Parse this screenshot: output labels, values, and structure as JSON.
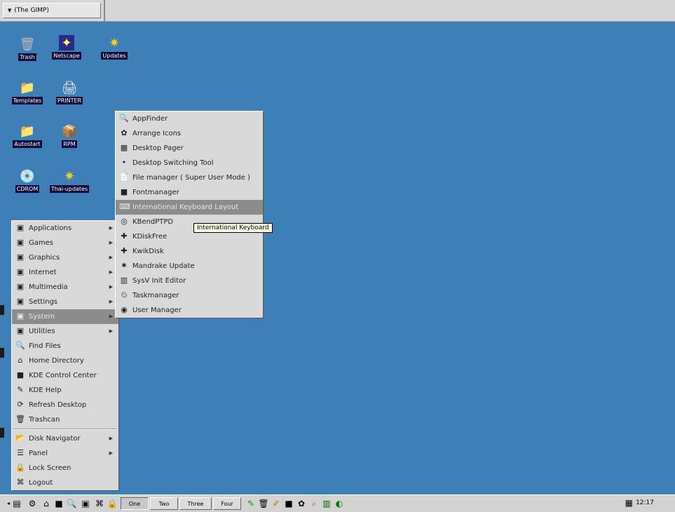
{
  "topbar": {
    "window_tab": "(The GIMP)"
  },
  "desktop_icons": [
    {
      "label": "Trash",
      "glyph": "🗑"
    },
    {
      "label": "Netscape",
      "glyph": "✦"
    },
    {
      "label": "Updates",
      "glyph": "✷"
    },
    {
      "label": "Templates",
      "glyph": "📁"
    },
    {
      "label": "PRINTER",
      "glyph": "🖨"
    },
    {
      "label": "Autostart",
      "glyph": "📁"
    },
    {
      "label": "RPM",
      "glyph": "📦"
    },
    {
      "label": "CDROM",
      "glyph": "💿"
    },
    {
      "label": "Thai-updates",
      "glyph": "✷"
    }
  ],
  "main_menu": [
    {
      "label": "Applications",
      "icon": "applications-icon",
      "glyph": "▣",
      "sub": true
    },
    {
      "label": "Games",
      "icon": "games-icon",
      "glyph": "▣",
      "sub": true
    },
    {
      "label": "Graphics",
      "icon": "graphics-icon",
      "glyph": "▣",
      "sub": true
    },
    {
      "label": "Internet",
      "icon": "internet-icon",
      "glyph": "▣",
      "sub": true
    },
    {
      "label": "Multimedia",
      "icon": "multimedia-icon",
      "glyph": "▣",
      "sub": true
    },
    {
      "label": "Settings",
      "icon": "settings-icon",
      "glyph": "▣",
      "sub": true
    },
    {
      "label": "System",
      "icon": "system-icon",
      "glyph": "▣",
      "sub": true,
      "highlighted": true
    },
    {
      "label": "Utilities",
      "icon": "utilities-icon",
      "glyph": "▣",
      "sub": true
    },
    {
      "label": "Find Files",
      "icon": "find-files-icon",
      "glyph": "🔍"
    },
    {
      "label": "Home Directory",
      "icon": "home-icon",
      "glyph": "⌂"
    },
    {
      "label": "KDE Control Center",
      "icon": "control-center-icon",
      "glyph": "■"
    },
    {
      "label": "KDE Help",
      "icon": "help-icon",
      "glyph": "✎"
    },
    {
      "label": "Refresh Desktop",
      "icon": "refresh-icon",
      "glyph": "⟳"
    },
    {
      "label": "Trashcan",
      "icon": "trashcan-icon",
      "glyph": "🗑"
    },
    {
      "label": "Disk Navigator",
      "icon": "disk-navigator-icon",
      "glyph": "📂",
      "sub": true,
      "sep_before": true
    },
    {
      "label": "Panel",
      "icon": "panel-icon",
      "glyph": "☰",
      "sub": true
    },
    {
      "label": "Lock Screen",
      "icon": "lock-icon",
      "glyph": "🔒"
    },
    {
      "label": "Logout",
      "icon": "logout-icon",
      "glyph": "⌘"
    }
  ],
  "system_submenu": [
    {
      "label": "AppFinder",
      "icon": "appfinder-icon",
      "glyph": "🔍"
    },
    {
      "label": "Arrange Icons",
      "icon": "arrange-icons-icon",
      "glyph": "✿"
    },
    {
      "label": "Desktop Pager",
      "icon": "pager-icon",
      "glyph": "▦"
    },
    {
      "label": "Desktop Switching Tool",
      "icon": "switch-tool-icon",
      "glyph": "•"
    },
    {
      "label": "File manager ( Super User Mode )",
      "icon": "file-manager-icon",
      "glyph": "📄"
    },
    {
      "label": "Fontmanager",
      "icon": "fontmanager-icon",
      "glyph": "■"
    },
    {
      "label": "International Keyboard Layout",
      "icon": "keyboard-layout-icon",
      "glyph": "⌨",
      "highlighted": true
    },
    {
      "label": "KBendPTPD",
      "icon": "kbendptpd-icon",
      "glyph": "◎"
    },
    {
      "label": "KDiskFree",
      "icon": "kdiskfree-icon",
      "glyph": "✚"
    },
    {
      "label": "KwikDisk",
      "icon": "kwikdisk-icon",
      "glyph": "✚"
    },
    {
      "label": "Mandrake Update",
      "icon": "mandrake-update-icon",
      "glyph": "✷"
    },
    {
      "label": "SysV Init Editor",
      "icon": "sysv-icon",
      "glyph": "▥"
    },
    {
      "label": "Taskmanager",
      "icon": "taskmanager-icon",
      "glyph": "⏲"
    },
    {
      "label": "User Manager",
      "icon": "user-manager-icon",
      "glyph": "◉"
    }
  ],
  "tooltip": "International Keyboard",
  "taskbar": {
    "pagers": [
      "One",
      "Two",
      "Three",
      "Four"
    ],
    "active_pager": 0,
    "clock": "12:17"
  }
}
